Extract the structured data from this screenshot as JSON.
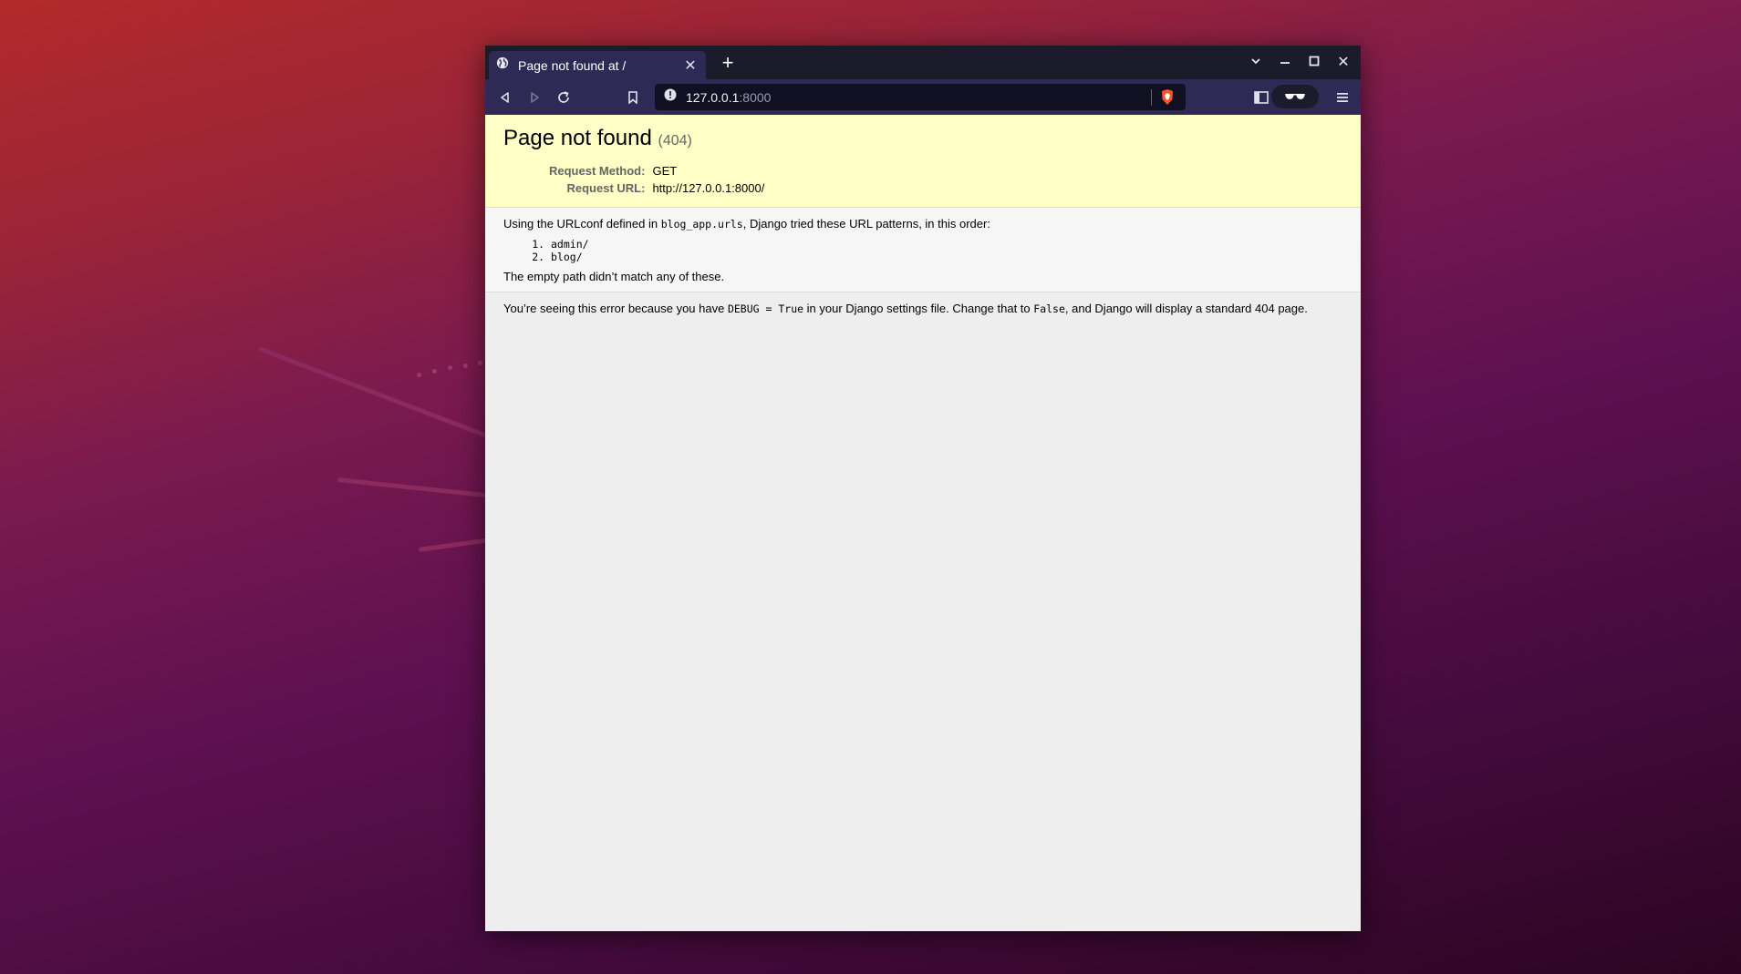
{
  "browser": {
    "tab_title": "Page not found at /",
    "url_host": "127.0.0.1",
    "url_port": ":8000",
    "icons": {
      "tab": "globe-icon",
      "back": "back-icon",
      "forward": "forward-icon",
      "reload": "reload-icon",
      "bookmark": "bookmark-icon",
      "site_info": "info-icon",
      "shields": "brave-shield-icon",
      "sidebar": "sidebar-icon",
      "reading": "glasses-icon",
      "menu": "menu-icon"
    }
  },
  "page": {
    "title": "Page not found",
    "status_code": "(404)",
    "request_method_label": "Request Method:",
    "request_method": "GET",
    "request_url_label": "Request URL:",
    "request_url": "http://127.0.0.1:8000/",
    "info_prefix": "Using the URLconf defined in ",
    "urlconf": "blog_app.urls",
    "info_suffix": ", Django tried these URL patterns, in this order:",
    "patterns": [
      "admin/",
      "blog/"
    ],
    "no_match": "The empty path didn’t match any of these.",
    "expl_1": "You’re seeing this error because you have ",
    "debug_code": "DEBUG = True",
    "expl_2": " in your Django settings file. Change that to ",
    "false_code": "False",
    "expl_3": ", and Django will display a standard 404 page."
  }
}
